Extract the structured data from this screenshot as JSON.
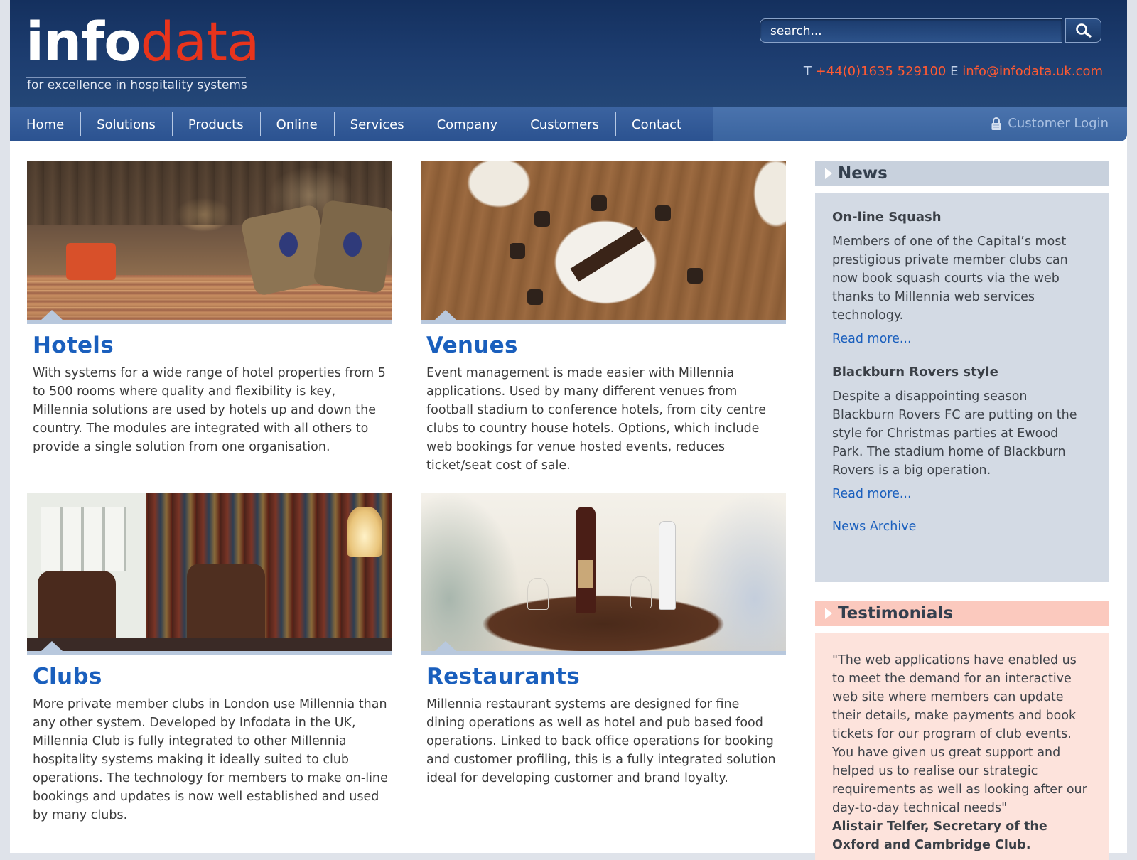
{
  "header": {
    "logo_info": "info",
    "logo_data": "data",
    "tagline": "for excellence in hospitality systems",
    "search_placeholder": "search...",
    "phone_label": "T",
    "phone": "+44(0)1635 529100",
    "email_label": "E",
    "email": "info@infodata.uk.com"
  },
  "nav": {
    "items": [
      "Home",
      "Solutions",
      "Products",
      "Online",
      "Services",
      "Company",
      "Customers",
      "Contact"
    ],
    "login": "Customer Login"
  },
  "blocks": [
    {
      "title": "Hotels",
      "text": "With systems for a wide range of hotel properties from 5 to 500 rooms where quality and flexibility is key, Millennia solutions are used by hotels up and down the country. The modules are integrated with all others to provide a single solution from one organisation."
    },
    {
      "title": "Venues",
      "text": "Event management is made easier with Millennia applications. Used by many different venues from football stadium to conference hotels, from city centre clubs to country house hotels. Options, which include web bookings for venue hosted events, reduces ticket/seat cost of sale."
    },
    {
      "title": "Clubs",
      "text": "More private member clubs in London use Millennia than any other system. Developed by Infodata in the UK, Millennia Club is fully integrated to other Millennia hospitality systems making it ideally suited to club operations. The technology for members to make on-line bookings and updates is now well established and used by many clubs."
    },
    {
      "title": "Restaurants",
      "text": "Millennia restaurant systems are designed for fine dining operations as well as hotel and pub based food operations. Linked to back office operations for booking and customer profiling, this is a fully integrated solution ideal for developing customer and brand loyalty."
    }
  ],
  "news": {
    "heading": "News",
    "items": [
      {
        "title": "On-line Squash",
        "text": "Members of one of the Capital’s most prestigious private member clubs can now book squash courts via the web thanks to Millennia web services technology.",
        "link": "Read more..."
      },
      {
        "title": "Blackburn Rovers style",
        "text": "Despite a disappointing season Blackburn Rovers FC are putting on the style for Christmas parties at Ewood Park. The stadium home of Blackburn Rovers is a big operation.",
        "link": "Read more..."
      }
    ],
    "archive": "News Archive"
  },
  "testimonials": {
    "heading": "Testimonials",
    "quote": "\"The web applications have enabled us to meet the demand for an interactive web site where members can update their details, make payments and book tickets for our program of club events. You have given us great support and helped us to realise our strategic requirements as well as looking after our day-to-day technical needs\"",
    "author": "Alistair Telfer, Secretary of the Oxford and Cambridge Club."
  },
  "colors": {
    "header_bg": "#1d3d70",
    "nav_bg": "#2b5290",
    "accent_blue": "#1a5fbd",
    "logo_red": "#e8341c",
    "news_bg": "#d3dae4",
    "testimonials_bg": "#fde3dc"
  },
  "icons": {
    "search": "magnifier-icon",
    "login": "lock-icon",
    "section": "triangle-right-icon"
  }
}
